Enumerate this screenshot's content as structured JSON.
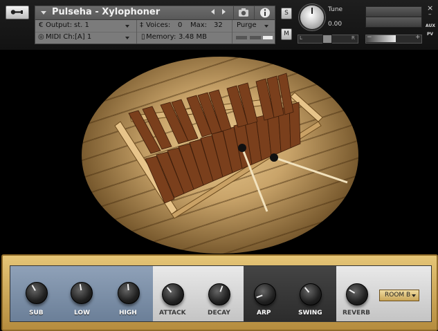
{
  "instrument": {
    "name": "Pulseha - Xylophoner",
    "output_label": "Output:",
    "output_value": "st. 1",
    "midi_label": "MIDI Ch:",
    "midi_value": "[A]  1",
    "voices_label": "Voices:",
    "voices_value": "0",
    "max_label": "Max:",
    "max_value": "32",
    "memory_label": "Memory:",
    "memory_value": "3.48 MB",
    "purge_label": "Purge"
  },
  "header_buttons": {
    "solo": "S",
    "mute": "M"
  },
  "tune": {
    "label": "Tune",
    "value": "0.00"
  },
  "pan": {
    "left": "L",
    "right": "R"
  },
  "volume": {
    "minus": "−",
    "plus": "+",
    "level": 0.55
  },
  "right_labels": {
    "close": "×",
    "minimize": "–",
    "aux": "AUX",
    "pv": "PV"
  },
  "controls": {
    "knobs": [
      {
        "label": "SUB"
      },
      {
        "label": "LOW"
      },
      {
        "label": "HIGH"
      },
      {
        "label": "ATTACK"
      },
      {
        "label": "DECAY"
      },
      {
        "label": "ARP"
      },
      {
        "label": "SWING"
      },
      {
        "label": "REVERB"
      }
    ],
    "reverb_room": "ROOM B"
  },
  "icons": [
    "wrench-icon",
    "dropdown-triangle-icon",
    "prev-arrow-icon",
    "next-arrow-icon",
    "camera-icon",
    "info-icon",
    "output-icon",
    "midi-icon",
    "voices-icon",
    "memory-icon",
    "purge-dropdown-icon"
  ]
}
